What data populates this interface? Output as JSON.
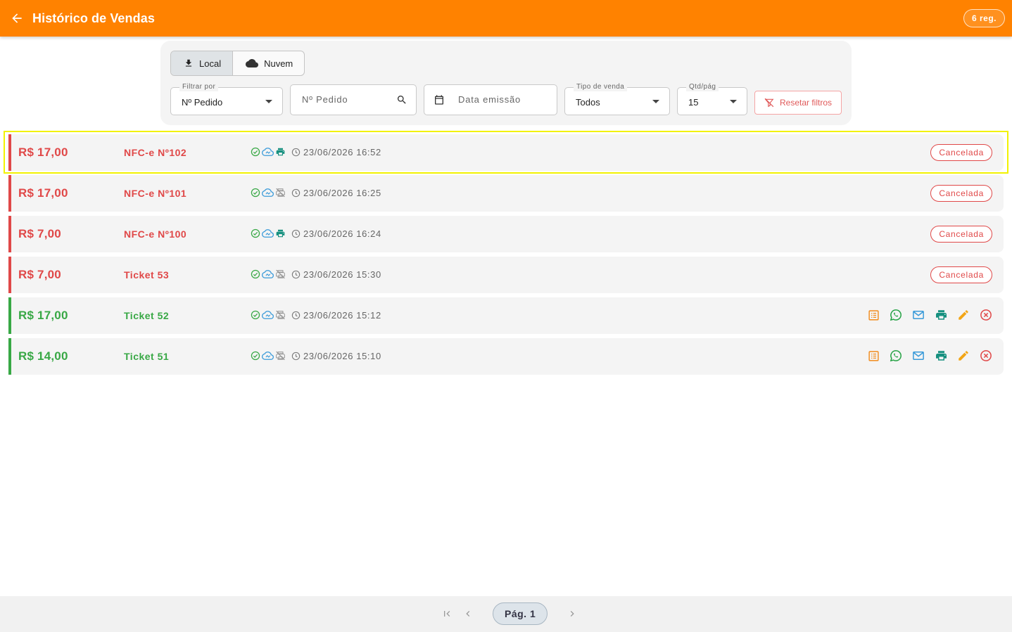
{
  "header": {
    "title": "Histórico de Vendas",
    "count_badge": "6 reg.",
    "background": "#ff8200"
  },
  "source_toggle": {
    "local_label": "Local",
    "cloud_label": "Nuvem",
    "selected": "Local"
  },
  "filters": {
    "filter_by": {
      "label": "Filtrar por",
      "value": "Nº Pedido"
    },
    "order_search": {
      "placeholder": "Nº Pedido"
    },
    "date": {
      "placeholder": "Data emissão"
    },
    "sale_type": {
      "label": "Tipo de venda",
      "value": "Todos"
    },
    "per_page": {
      "label": "Qtd/pág",
      "value": "15"
    },
    "reset_label": "Resetar filtros"
  },
  "sales": [
    {
      "amount": "R$ 17,00",
      "doc": "NFC-e Nº102",
      "date": "23/06/2026 16:52",
      "status": "Cancelada",
      "cancelled": true,
      "printed": true
    },
    {
      "amount": "R$ 17,00",
      "doc": "NFC-e Nº101",
      "date": "23/06/2026 16:25",
      "status": "Cancelada",
      "cancelled": true,
      "printed": false
    },
    {
      "amount": "R$ 7,00",
      "doc": "NFC-e Nº100",
      "date": "23/06/2026 16:24",
      "status": "Cancelada",
      "cancelled": true,
      "printed": true
    },
    {
      "amount": "R$ 7,00",
      "doc": "Ticket 53",
      "date": "23/06/2026 15:30",
      "status": "Cancelada",
      "cancelled": true,
      "printed": false
    },
    {
      "amount": "R$ 17,00",
      "doc": "Ticket 52",
      "date": "23/06/2026 15:12",
      "status": "",
      "cancelled": false,
      "printed": false
    },
    {
      "amount": "R$ 14,00",
      "doc": "Ticket 51",
      "date": "23/06/2026 15:10",
      "status": "",
      "cancelled": false,
      "printed": false
    }
  ],
  "row_icons": [
    "check-circle-icon",
    "cloud-sync-icon",
    "printer-icon",
    "clock-icon"
  ],
  "row_actions": [
    "receipt-icon",
    "whatsapp-icon",
    "email-icon",
    "printer-icon",
    "edit-icon",
    "cancel-icon"
  ],
  "pagination": {
    "page_label": "Pág. 1"
  },
  "colors": {
    "cancelled": "#e04848",
    "active": "#38a845",
    "accent": "#ff8200",
    "cloud": "#3a9ad9",
    "printer": "#16907f"
  }
}
